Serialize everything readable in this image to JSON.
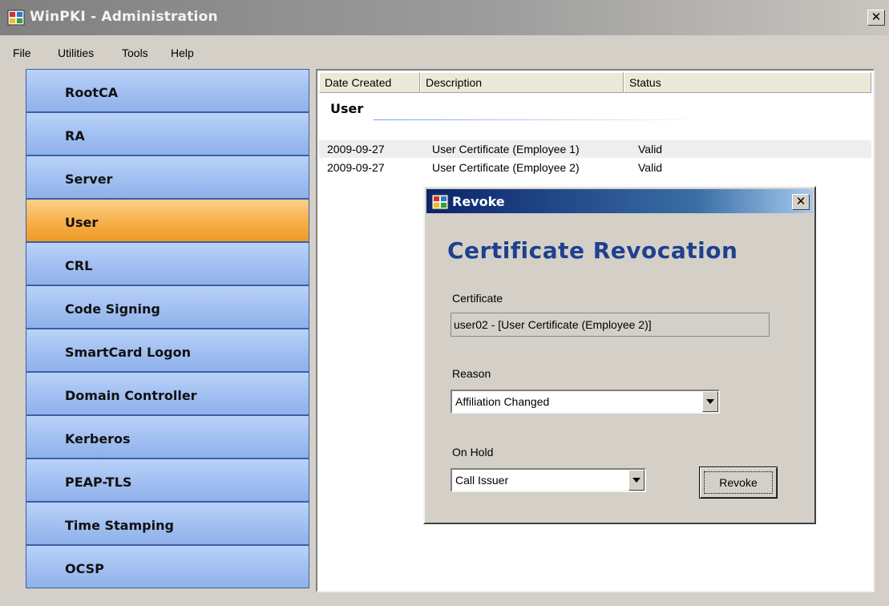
{
  "window": {
    "title": "WinPKI - Administration",
    "close_icon": "close-icon"
  },
  "menu": {
    "items": [
      "File",
      "Utilities",
      "Tools",
      "Help"
    ]
  },
  "sidebar": {
    "items": [
      {
        "label": "RootCA",
        "active": false
      },
      {
        "label": "RA",
        "active": false
      },
      {
        "label": "Server",
        "active": false
      },
      {
        "label": "User",
        "active": true
      },
      {
        "label": "CRL",
        "active": false
      },
      {
        "label": "Code Signing",
        "active": false
      },
      {
        "label": "SmartCard Logon",
        "active": false
      },
      {
        "label": "Domain Controller",
        "active": false
      },
      {
        "label": "Kerberos",
        "active": false
      },
      {
        "label": "PEAP-TLS",
        "active": false
      },
      {
        "label": "Time Stamping",
        "active": false
      },
      {
        "label": "OCSP",
        "active": false
      }
    ],
    "colors": {
      "normal": "#a5c2f2",
      "active": "#f7b24d"
    }
  },
  "list": {
    "columns": [
      "Date Created",
      "Description",
      "Status"
    ],
    "group": "User",
    "rows": [
      {
        "date": "2009-09-27",
        "description": "User Certificate (Employee 1)",
        "status": "Valid"
      },
      {
        "date": "2009-09-27",
        "description": "User Certificate (Employee 2)",
        "status": "Valid"
      }
    ]
  },
  "dialog": {
    "title": "Revoke",
    "heading": "Certificate Revocation",
    "certificate_label": "Certificate",
    "certificate_value": "user02 - [User Certificate (Employee 2)]",
    "reason_label": "Reason",
    "reason_value": "Affiliation Changed",
    "onhold_label": "On Hold",
    "onhold_value": "Call Issuer",
    "revoke_button": "Revoke",
    "heading_color": "#1f3f8f"
  }
}
